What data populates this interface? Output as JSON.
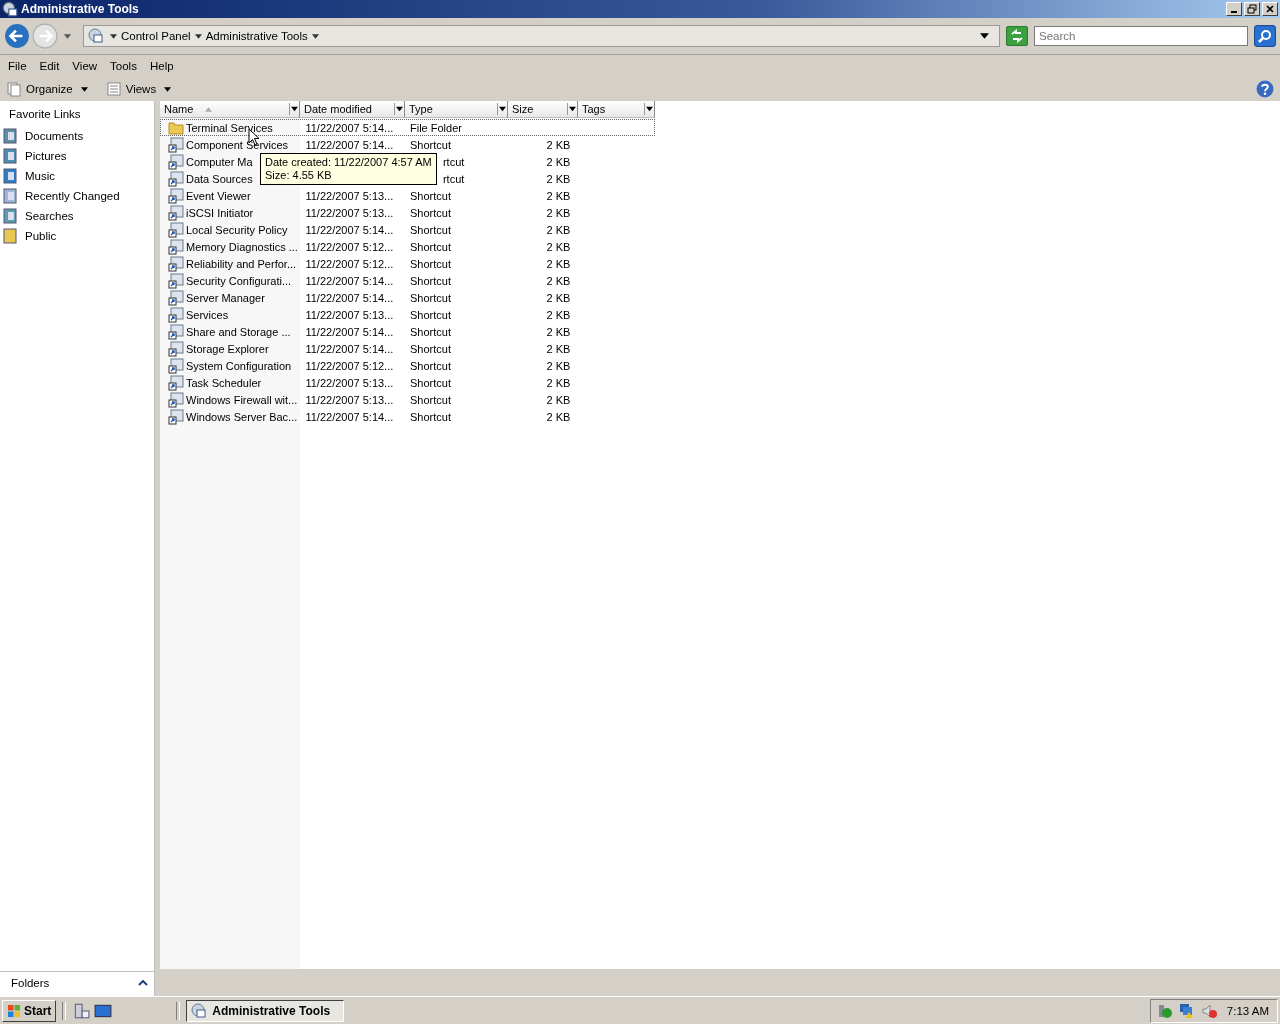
{
  "window": {
    "title": "Administrative Tools"
  },
  "address": {
    "crumbs": [
      "Control Panel",
      "Administrative Tools"
    ],
    "search_placeholder": "Search"
  },
  "menu": [
    "File",
    "Edit",
    "View",
    "Tools",
    "Help"
  ],
  "toolbar": [
    "Organize",
    "Views"
  ],
  "sidebar": {
    "title": "Favorite Links",
    "items": [
      {
        "label": "Documents",
        "kind": "documents"
      },
      {
        "label": "Pictures",
        "kind": "pictures"
      },
      {
        "label": "Music",
        "kind": "music"
      },
      {
        "label": "Recently Changed",
        "kind": "recent"
      },
      {
        "label": "Searches",
        "kind": "searches"
      },
      {
        "label": "Public",
        "kind": "folder"
      }
    ],
    "folders": "Folders"
  },
  "table": {
    "columns": [
      "Name",
      "Date modified",
      "Type",
      "Size",
      "Tags"
    ],
    "rows": [
      {
        "kind": "folder",
        "focused": true,
        "covered": false,
        "name": "Terminal Services",
        "date": "11/22/2007 5:14...",
        "type": "File Folder"
      },
      {
        "kind": "shortcut",
        "focused": false,
        "covered": false,
        "name": "Component Services",
        "date": "11/22/2007 5:14...",
        "type": "Shortcut",
        "size": "2 KB"
      },
      {
        "kind": "shortcut",
        "focused": false,
        "covered": true,
        "name": "Computer Ma",
        "type": "rtcut",
        "size": "2 KB"
      },
      {
        "kind": "shortcut",
        "focused": false,
        "covered": true,
        "name": "Data Sources",
        "type": "rtcut",
        "size": "2 KB"
      },
      {
        "kind": "shortcut",
        "focused": false,
        "covered": false,
        "name": "Event Viewer",
        "date": "11/22/2007 5:13...",
        "type": "Shortcut",
        "size": "2 KB"
      },
      {
        "kind": "shortcut",
        "focused": false,
        "covered": false,
        "name": "iSCSI Initiator",
        "date": "11/22/2007 5:13...",
        "type": "Shortcut",
        "size": "2 KB"
      },
      {
        "kind": "shortcut",
        "focused": false,
        "covered": false,
        "name": "Local Security Policy",
        "date": "11/22/2007 5:14...",
        "type": "Shortcut",
        "size": "2 KB"
      },
      {
        "kind": "shortcut",
        "focused": false,
        "covered": false,
        "name": "Memory Diagnostics ...",
        "date": "11/22/2007 5:12...",
        "type": "Shortcut",
        "size": "2 KB"
      },
      {
        "kind": "shortcut",
        "focused": false,
        "covered": false,
        "name": "Reliability and Perfor...",
        "date": "11/22/2007 5:12...",
        "type": "Shortcut",
        "size": "2 KB"
      },
      {
        "kind": "shortcut",
        "focused": false,
        "covered": false,
        "name": "Security Configurati...",
        "date": "11/22/2007 5:14...",
        "type": "Shortcut",
        "size": "2 KB"
      },
      {
        "kind": "shortcut",
        "focused": false,
        "covered": false,
        "name": "Server Manager",
        "date": "11/22/2007 5:14...",
        "type": "Shortcut",
        "size": "2 KB"
      },
      {
        "kind": "shortcut",
        "focused": false,
        "covered": false,
        "name": "Services",
        "date": "11/22/2007 5:13...",
        "type": "Shortcut",
        "size": "2 KB"
      },
      {
        "kind": "shortcut",
        "focused": false,
        "covered": false,
        "name": "Share and Storage ...",
        "date": "11/22/2007 5:14...",
        "type": "Shortcut",
        "size": "2 KB"
      },
      {
        "kind": "shortcut",
        "focused": false,
        "covered": false,
        "name": "Storage Explorer",
        "date": "11/22/2007 5:14...",
        "type": "Shortcut",
        "size": "2 KB"
      },
      {
        "kind": "shortcut",
        "focused": false,
        "covered": false,
        "name": "System Configuration",
        "date": "11/22/2007 5:12...",
        "type": "Shortcut",
        "size": "2 KB"
      },
      {
        "kind": "shortcut",
        "focused": false,
        "covered": false,
        "name": "Task Scheduler",
        "date": "11/22/2007 5:13...",
        "type": "Shortcut",
        "size": "2 KB"
      },
      {
        "kind": "shortcut",
        "focused": false,
        "covered": false,
        "name": "Windows Firewall wit...",
        "date": "11/22/2007 5:13...",
        "type": "Shortcut",
        "size": "2 KB"
      },
      {
        "kind": "shortcut",
        "focused": false,
        "covered": false,
        "name": "Windows Server Bac...",
        "date": "11/22/2007 5:14...",
        "type": "Shortcut",
        "size": "2 KB"
      }
    ]
  },
  "tooltip": [
    "Date created: 11/22/2007 4:57 AM",
    "Size: 4.55 KB"
  ],
  "taskbar": {
    "start": "Start",
    "task": "Administrative Tools",
    "clock": "7:13 AM"
  }
}
